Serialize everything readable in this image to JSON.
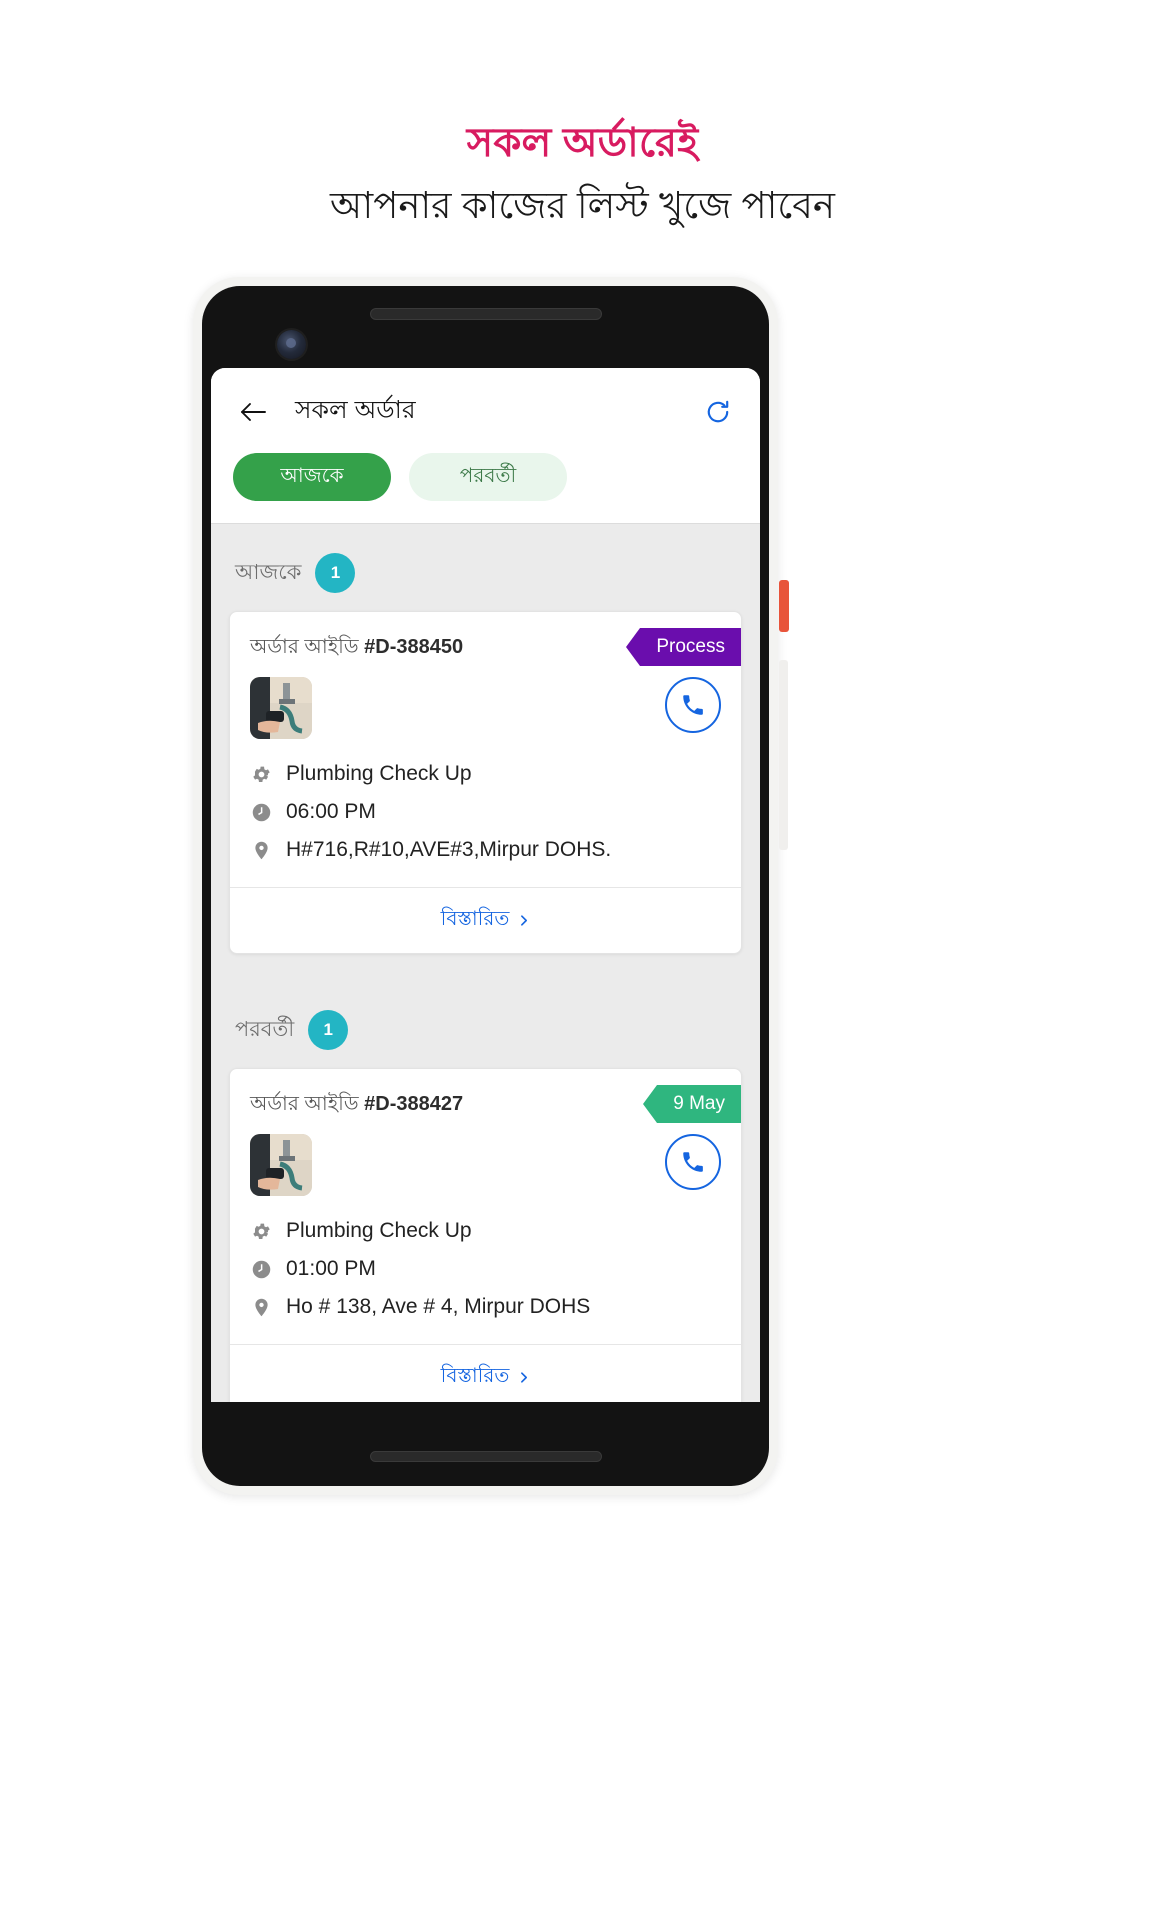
{
  "promo": {
    "headline_main": "সকল অর্ডারেই",
    "headline_sub": "আপনার কাজের লিস্ট খুজে পাবেন",
    "headline_color": "#d81b60"
  },
  "app": {
    "appbar": {
      "back_icon": "back-arrow-icon",
      "title": "সকল অর্ডার",
      "refresh_icon": "refresh-icon"
    },
    "tabs": [
      {
        "label": "আজকে",
        "active": true
      },
      {
        "label": "পরবর্তী",
        "active": false
      }
    ],
    "sections": [
      {
        "label": "আজকে",
        "count": "1",
        "orders": [
          {
            "order_id_label": "অর্ডার আইডি",
            "order_id_value": "#D-388450",
            "badge_text": "Process",
            "badge_color": "#6a0dad",
            "service_icon": "gear-icon",
            "service": "Plumbing Check Up",
            "time_icon": "clock-icon",
            "time": "06:00 PM",
            "location_icon": "location-pin-icon",
            "address": "H#716,R#10,AVE#3,Mirpur DOHS.",
            "call_icon": "phone-icon",
            "detail_label": "বিস্তারিত"
          }
        ]
      },
      {
        "label": "পরবর্তী",
        "count": "1",
        "orders": [
          {
            "order_id_label": "অর্ডার আইডি",
            "order_id_value": "#D-388427",
            "badge_text": "9 May",
            "badge_color": "#2fb67f",
            "service_icon": "gear-icon",
            "service": "Plumbing Check Up",
            "time_icon": "clock-icon",
            "time": "01:00 PM",
            "location_icon": "location-pin-icon",
            "address": "Ho # 138, Ave # 4, Mirpur DOHS",
            "call_icon": "phone-icon",
            "detail_label": "বিস্তারিত"
          }
        ]
      }
    ],
    "colors": {
      "tab_active_bg": "#34a14a",
      "tab_inactive_bg": "#e9f6ec",
      "count_badge_bg": "#23b5c4",
      "link": "#1565e0"
    }
  }
}
